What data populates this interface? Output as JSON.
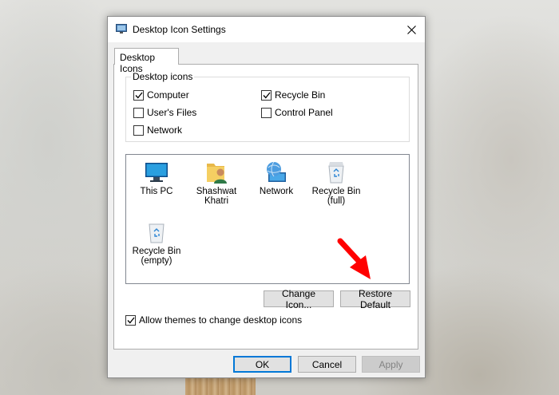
{
  "window": {
    "title": "Desktop Icon Settings",
    "tab": "Desktop Icons",
    "close_icon": "close-icon"
  },
  "desktop_icons_group": {
    "label": "Desktop icons",
    "checkboxes": [
      {
        "label": "Computer",
        "checked": true
      },
      {
        "label": "Recycle Bin",
        "checked": true
      },
      {
        "label": "User's Files",
        "checked": false
      },
      {
        "label": "Control Panel",
        "checked": false
      },
      {
        "label": "Network",
        "checked": false
      }
    ]
  },
  "icons": [
    {
      "label": "This PC",
      "icon": "monitor-icon"
    },
    {
      "label": "Shashwat Khatri",
      "icon": "user-folder-icon"
    },
    {
      "label": "Network",
      "icon": "network-globe-icon"
    },
    {
      "label": "Recycle Bin (full)",
      "icon": "recycle-bin-full-icon"
    },
    {
      "label": "Recycle Bin (empty)",
      "icon": "recycle-bin-empty-icon"
    }
  ],
  "buttons": {
    "change_icon": "Change Icon...",
    "restore_default": "Restore Default",
    "ok": "OK",
    "cancel": "Cancel",
    "apply": "Apply"
  },
  "allow_themes": {
    "label": "Allow themes to change desktop icons",
    "checked": true
  },
  "colors": {
    "accent": "#0078d7",
    "annotation_arrow": "#ff0000"
  }
}
